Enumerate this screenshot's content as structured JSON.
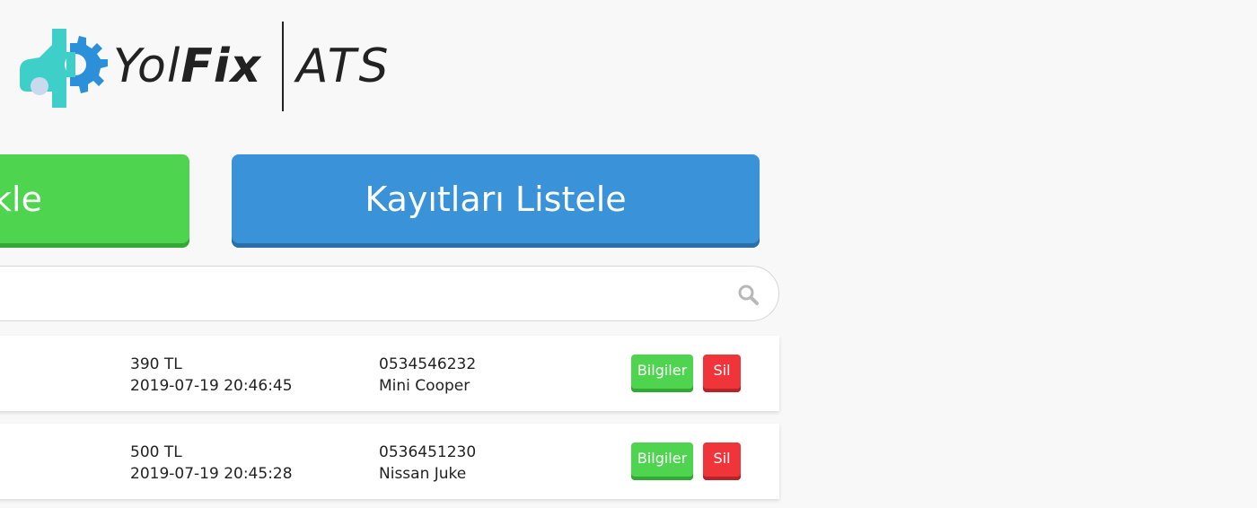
{
  "logo": {
    "brand_light": "Yol",
    "brand_bold": "Fix",
    "product": "ATS",
    "icon": "car-gear-icon",
    "colors": {
      "car": "#3ecfc9",
      "gear": "#2b8fd9",
      "text": "#222222"
    }
  },
  "actions": {
    "add_label": "kle",
    "list_label": "Kayıtları Listele"
  },
  "search": {
    "value": "",
    "icon": "search-icon"
  },
  "records": [
    {
      "price": "390 TL",
      "datetime": "2019-07-19 20:46:45",
      "phone": "0534546232",
      "vehicle": "Mini Cooper",
      "info_label": "Bilgiler",
      "delete_label": "Sil"
    },
    {
      "price": "500 TL",
      "datetime": "2019-07-19 20:45:28",
      "phone": "0536451230",
      "vehicle": "Nissan Juke",
      "info_label": "Bilgiler",
      "delete_label": "Sil"
    }
  ],
  "colors": {
    "green": "#4fd44f",
    "blue": "#3a92d8",
    "red": "#f0353a",
    "background": "#f8f8f8"
  }
}
